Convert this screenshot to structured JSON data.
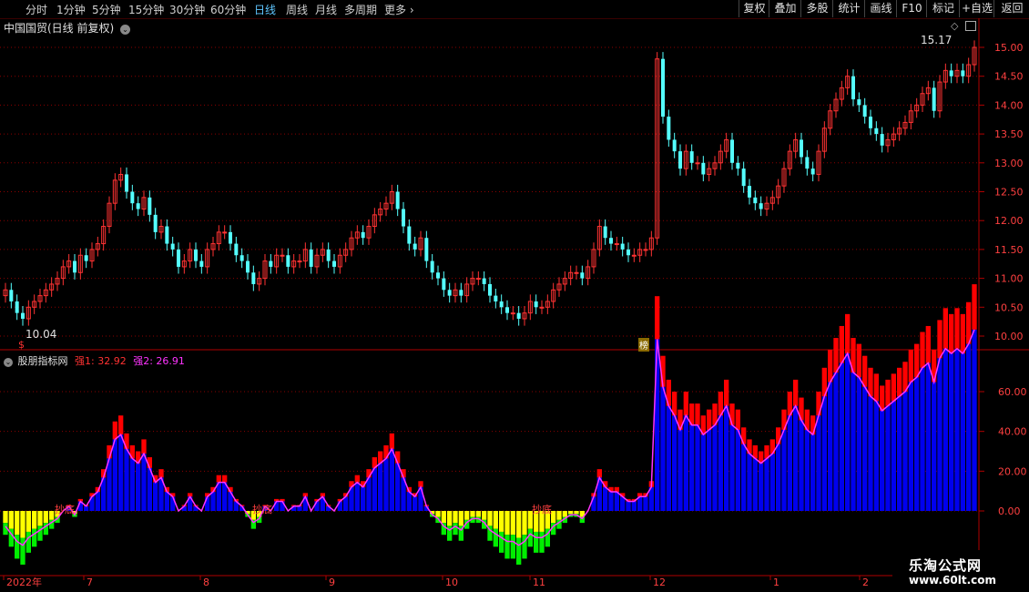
{
  "toolbar": {
    "periods": [
      "分时",
      "1分钟",
      "5分钟",
      "15分钟",
      "30分钟",
      "60分钟",
      "日线",
      "周线",
      "月线",
      "多周期",
      "更多"
    ],
    "active_period": "日线",
    "right_buttons": [
      "复权",
      "叠加",
      "多股",
      "统计",
      "画线",
      "F10",
      "标记",
      "+自选",
      "返回"
    ]
  },
  "main_chart": {
    "title": "中国国贸(日线 前复权)",
    "price_labels": [
      "15.00",
      "14.50",
      "14.00",
      "13.50",
      "13.00",
      "12.50",
      "12.00",
      "11.50",
      "11.00",
      "10.50",
      "10.00"
    ],
    "high_label": "15.17",
    "low_label": "10.04",
    "marker_bang": "榜",
    "marker_dollar": "$"
  },
  "indicator": {
    "name": "股朋指标网",
    "q1_label": "强1: 32.92",
    "q2_label": "强2: 26.91",
    "axis_labels": [
      "60.00",
      "40.00",
      "20.00",
      "0.00"
    ],
    "bottom_labels": [
      "抄底",
      "抄底",
      "抄底"
    ]
  },
  "timeline": {
    "labels": [
      "2022年",
      "7",
      "8",
      "9",
      "10",
      "11",
      "12",
      "1",
      "2"
    ]
  },
  "watermark": {
    "title": "乐淘公式网",
    "url": "www.60lt.com"
  },
  "colors": {
    "up": "#ff3232",
    "down": "#54ffff",
    "grid": "#8b0000",
    "blue_bar": "#0000ee",
    "red_bar": "#ff0000",
    "yellow_bar": "#ffff00",
    "green_bar": "#00ee00",
    "magenta_line": "#ff33ff"
  }
}
